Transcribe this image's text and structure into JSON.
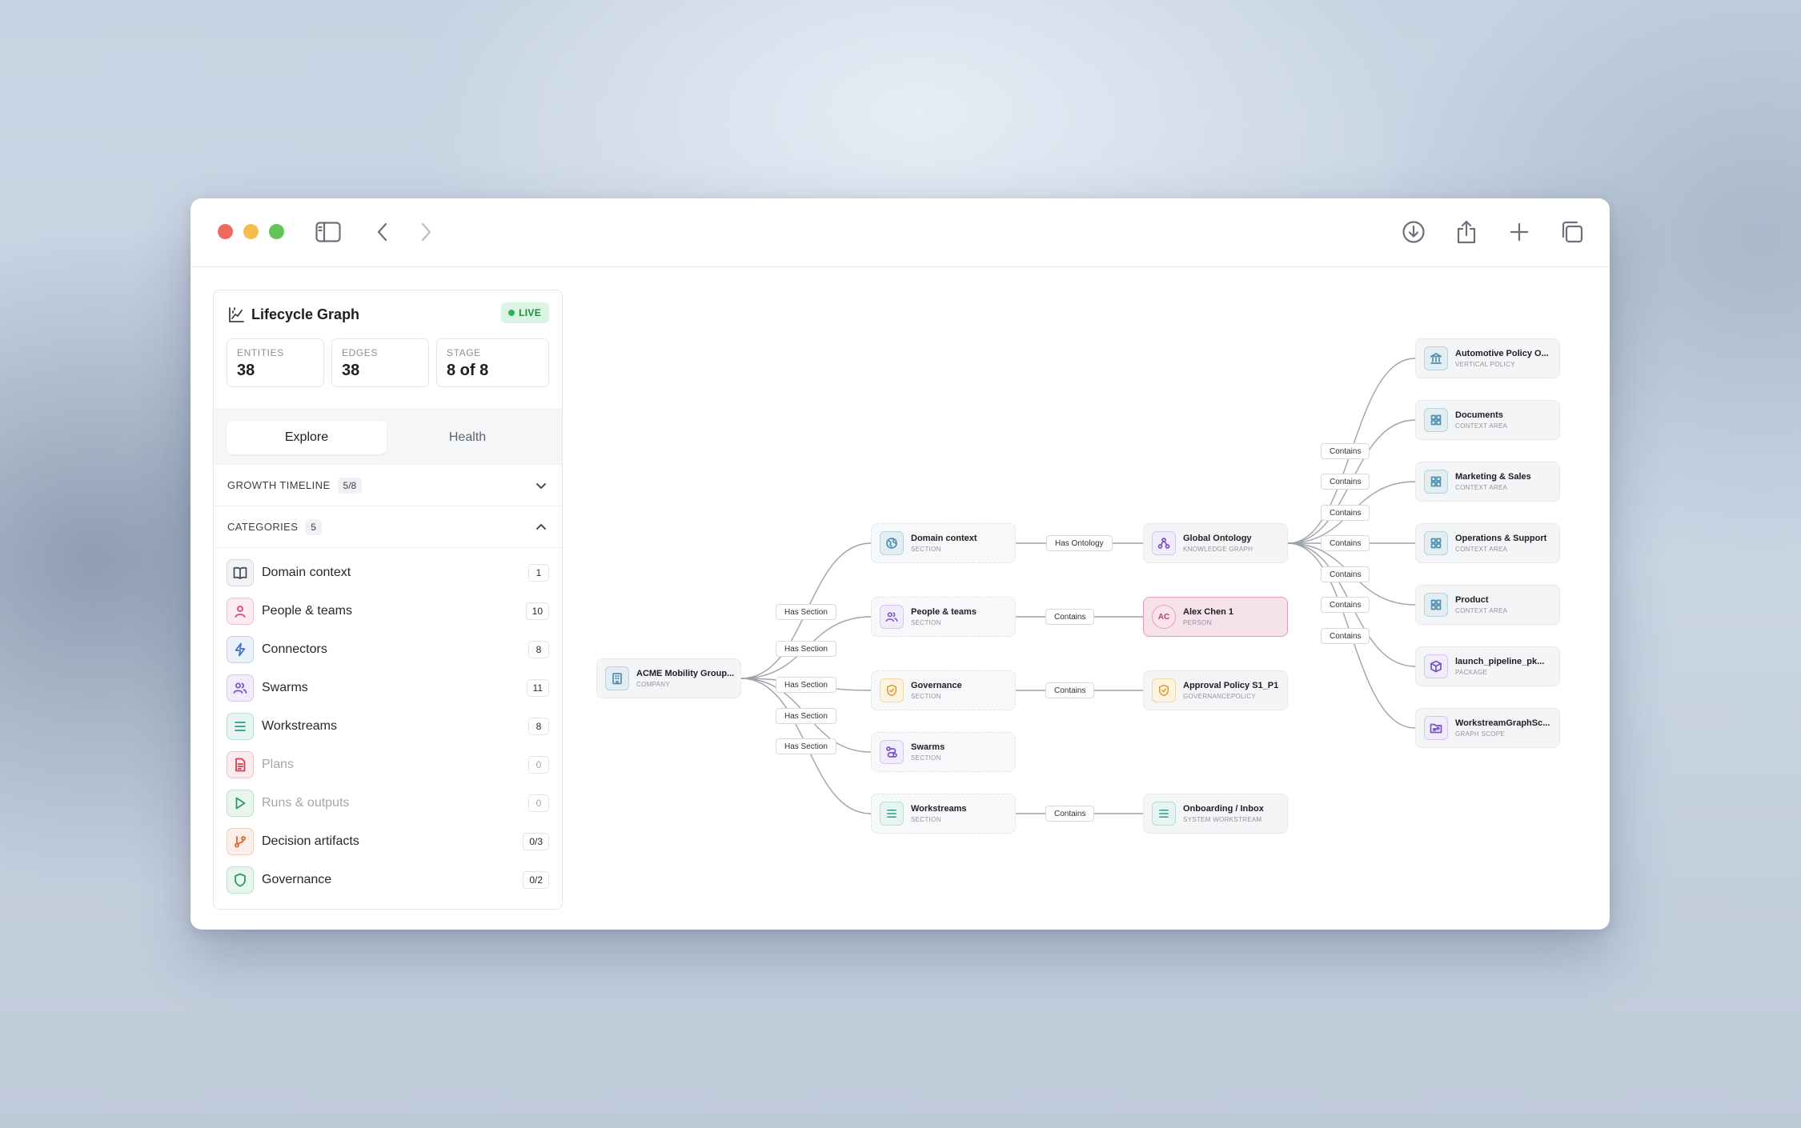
{
  "panel": {
    "title": "Lifecycle Graph",
    "live_badge": "LIVE",
    "stats": [
      {
        "label": "ENTITIES",
        "value": "38"
      },
      {
        "label": "EDGES",
        "value": "38"
      },
      {
        "label": "STAGE",
        "value": "8 of 8"
      }
    ],
    "tabs": {
      "explore": "Explore",
      "health": "Health"
    },
    "growth_timeline": {
      "label": "GROWTH TIMELINE",
      "badge": "5/8"
    },
    "categories_header": {
      "label": "CATEGORIES",
      "badge": "5"
    },
    "categories": [
      {
        "label": "Domain context",
        "count": "1"
      },
      {
        "label": "People & teams",
        "count": "10"
      },
      {
        "label": "Connectors",
        "count": "8"
      },
      {
        "label": "Swarms",
        "count": "11"
      },
      {
        "label": "Workstreams",
        "count": "8"
      },
      {
        "label": "Plans",
        "count": "0"
      },
      {
        "label": "Runs & outputs",
        "count": "0"
      },
      {
        "label": "Decision artifacts",
        "count": "0/3"
      },
      {
        "label": "Governance",
        "count": "0/2"
      }
    ]
  },
  "graph": {
    "nodes": {
      "company": {
        "name": "ACME Mobility Group...",
        "type": "COMPANY"
      },
      "domain": {
        "name": "Domain context",
        "type": "SECTION"
      },
      "people": {
        "name": "People & teams",
        "type": "SECTION"
      },
      "governance": {
        "name": "Governance",
        "type": "SECTION"
      },
      "swarms": {
        "name": "Swarms",
        "type": "SECTION"
      },
      "workstreams": {
        "name": "Workstreams",
        "type": "SECTION"
      },
      "ontology": {
        "name": "Global Ontology",
        "type": "KNOWLEDGE GRAPH"
      },
      "alex": {
        "name": "Alex Chen 1",
        "type": "PERSON",
        "initials": "AC"
      },
      "approval": {
        "name": "Approval Policy S1_P1",
        "type": "GOVERNANCEPOLICY"
      },
      "onboarding": {
        "name": "Onboarding / Inbox",
        "type": "SYSTEM WORKSTREAM"
      },
      "automotive": {
        "name": "Automotive Policy O...",
        "type": "VERTICAL POLICY"
      },
      "documents": {
        "name": "Documents",
        "type": "CONTEXT AREA"
      },
      "marketing": {
        "name": "Marketing & Sales",
        "type": "CONTEXT AREA"
      },
      "operations": {
        "name": "Operations & Support",
        "type": "CONTEXT AREA"
      },
      "product": {
        "name": "Product",
        "type": "CONTEXT AREA"
      },
      "launch": {
        "name": "launch_pipeline_pk...",
        "type": "PACKAGE"
      },
      "workstreamgraph": {
        "name": "WorkstreamGraphSc...",
        "type": "GRAPH SCOPE"
      }
    },
    "edge_labels": {
      "has_section": "Has Section",
      "has_ontology": "Has Ontology",
      "contains": "Contains"
    }
  },
  "icons": {
    "toolbar": [
      "sidebar-icon",
      "back-icon",
      "forward-icon",
      "download-icon",
      "share-icon",
      "plus-icon",
      "tabs-icon"
    ],
    "colors": {
      "live_bg": "#dcf4e3",
      "live_text": "#1f8a44",
      "blue": "#4f8fb0",
      "pink": "#d6477e",
      "purple": "#7a52c7",
      "teal": "#2f9b86",
      "amber": "#d9962a",
      "red": "#d83a4a",
      "green": "#2f9b5a",
      "orange": "#e0622c"
    }
  }
}
